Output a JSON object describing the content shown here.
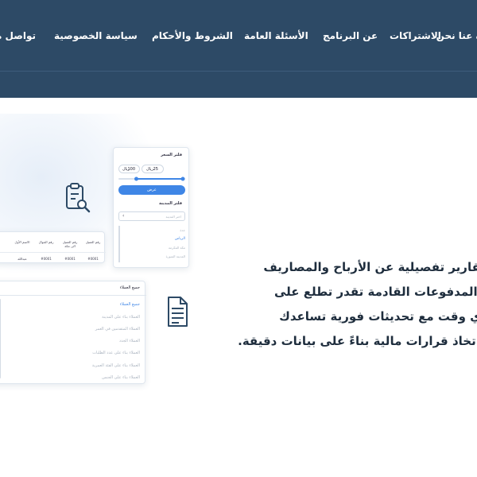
{
  "nav": {
    "items": [
      {
        "label": "نبذة عنا نحن",
        "key": "about-us"
      },
      {
        "label": "الاشتراكات",
        "key": "subscriptions"
      },
      {
        "label": "عن البرنامج",
        "key": "about-app"
      },
      {
        "label": "الأسئلة العامة",
        "key": "faq"
      },
      {
        "label": "الشروط والأحكام",
        "key": "terms"
      },
      {
        "label": "سياسة الخصوصية",
        "key": "privacy"
      },
      {
        "label": "تواصل معنا",
        "key": "contact"
      }
    ]
  },
  "description": {
    "lines": [
      "تقارير تفصيلية عن الأرباح والمصاريف",
      "والمدفوعات القادمة تقدر تطلع على",
      "أي وقت مع تحديثات فورية تساعدك",
      "باتخاذ قرارات مالية بناءً على بيانات دقيقة."
    ]
  },
  "price_filter": {
    "title": "فلتر السعر",
    "min_value": "25",
    "max_value": "100",
    "currency": "ريال",
    "show_button": "عرض",
    "range_fraction": [
      0.25,
      1.0
    ]
  },
  "city_filter": {
    "title": "فلتر المدينة",
    "select_placeholder": "اختر المدينة",
    "options": [
      "جدة",
      "الرياض",
      "مكة المكرمة",
      "المدينة المنورة"
    ],
    "active_index": 1
  },
  "clients_table": {
    "headers": [
      "رقم العميل",
      "رقم العميل الى مكة",
      "رقم الجوال",
      "الاسم الأول"
    ],
    "row": [
      "#0001",
      "#0001",
      "#0001",
      "عبدالله"
    ]
  },
  "clients_list": {
    "header": "جميع العملاء",
    "items": [
      "جميع العملاء",
      "العملاء بناء على المدينة",
      "العملاء المتقدمين في العمر",
      "العملاء الجدد",
      "العملاء بناء على عدد الطلبات",
      "العملاء بناء على الفئة العمرية",
      "العملاء بناء على الجنس"
    ],
    "active_index": 0
  },
  "icons": {
    "report": "clipboard-search-icon",
    "document": "document-list-icon"
  },
  "colors": {
    "header_bg": "#2d4a66",
    "accent": "#3f86e6",
    "text_dark": "#1e2d3d",
    "icon_color": "#2d4a66"
  }
}
